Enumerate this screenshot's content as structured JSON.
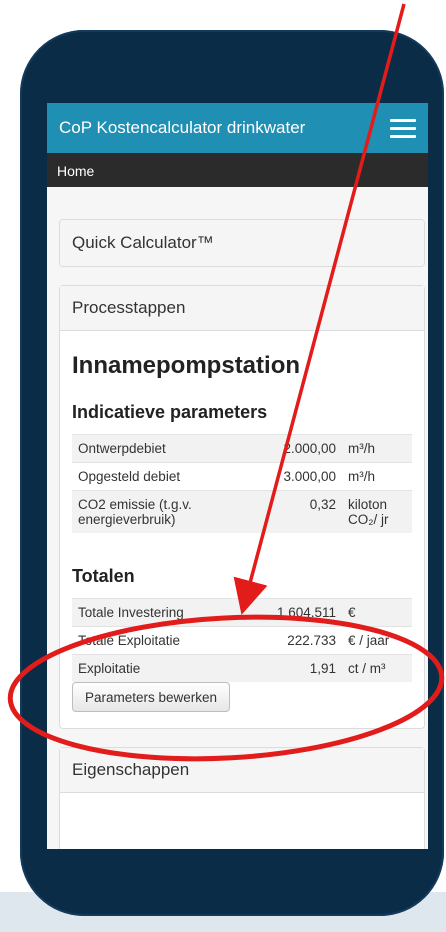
{
  "app": {
    "title": "CoP Kostencalculator drinkwater"
  },
  "breadcrumb": {
    "home": "Home"
  },
  "panels": {
    "quick": "Quick Calculator™",
    "processtappen": "Processtappen",
    "eigenschappen": "Eigenschappen"
  },
  "station": {
    "title": "Innamepompstation",
    "params_heading": "Indicatieve parameters",
    "params": [
      {
        "label": "Ontwerpdebiet",
        "value": "2.000,00",
        "unit": "m³/h"
      },
      {
        "label": "Opgesteld debiet",
        "value": "3.000,00",
        "unit": "m³/h"
      },
      {
        "label": "CO2 emissie (t.g.v. energieverbruik)",
        "value": "0,32",
        "unit": "kiloton CO₂/ jr"
      }
    ],
    "totals_heading": "Totalen",
    "totals": [
      {
        "label": "Totale Investering",
        "value": "1.604.511",
        "unit": "€"
      },
      {
        "label": "Totale Exploitatie",
        "value": "222.733",
        "unit": "€ / jaar"
      },
      {
        "label": "Exploitatie",
        "value": "1,91",
        "unit": "ct / m³"
      }
    ],
    "button_label": "Parameters bewerken"
  },
  "colors": {
    "appbar": "#1f8fb4",
    "phone": "#0a2c47",
    "annotation": "#e21b1b"
  },
  "icons": {
    "menu": "hamburger-menu-icon"
  }
}
